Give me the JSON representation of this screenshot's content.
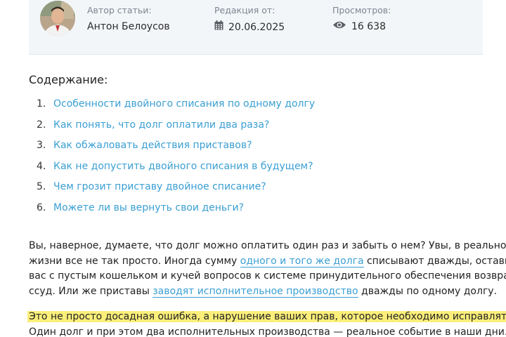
{
  "author_card": {
    "author_label": "Автор статьи:",
    "author_name": "Антон Белоусов",
    "edition_label": "Редакция от:",
    "edition_date": "20.06.2025",
    "views_label": "Просмотров:",
    "views_count": "16 638",
    "icons": {
      "date": "calendar-icon",
      "views": "eye-icon"
    }
  },
  "toc": {
    "title": "Содержание:",
    "items": [
      {
        "num": "1.",
        "label": "Особенности двойного списания по одному долгу"
      },
      {
        "num": "2.",
        "label": "Как понять, что долг оплатили два раза?"
      },
      {
        "num": "3.",
        "label": "Как обжаловать действия приставов?"
      },
      {
        "num": "4.",
        "label": "Как не допустить двойного списания в будущем?"
      },
      {
        "num": "5.",
        "label": "Чем грозит приставу двойное списание?"
      },
      {
        "num": "6.",
        "label": "Можете ли вы вернуть свои деньги?"
      }
    ]
  },
  "article": {
    "p1": {
      "l1": "Вы, наверное, думаете, что долг можно оплатить один раз и забыть о нем? Увы, в реальной",
      "l2_a": "жизни все не так просто. Иногда сумму ",
      "l2_link": "одного и того же долга",
      "l2_b": " списывают дважды, оставив",
      "l3": "вас с пустым кошельком и кучей вопросов к системе принудительного обеспечения возврата",
      "l4_a": "ссуд. Или же приставы ",
      "l4_link": "заводят исполнительное производство",
      "l4_b": " дважды по одному долгу."
    },
    "p2": {
      "highlight": "Это не просто досадная ошибка, а нарушение ваших прав, которое необходимо исправлять.",
      "l2": "Один долг и при этом два исполнительных производства — реальное событие в наши дни."
    }
  },
  "colors": {
    "link": "#3a9fd3",
    "highlight": "#fbef7a",
    "card_bg": "#f3f6f9"
  }
}
